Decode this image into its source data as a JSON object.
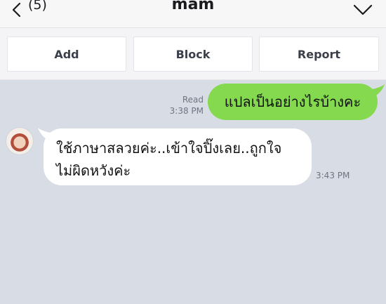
{
  "header": {
    "back_icon": "chevron-left-icon",
    "unread_count": "(5)",
    "title": "mam",
    "menu_icon": "chevron-down-icon"
  },
  "actions": {
    "add_label": "Add",
    "block_label": "Block",
    "report_label": "Report"
  },
  "messages": [
    {
      "direction": "outgoing",
      "status": "Read",
      "time": "3:38 PM",
      "text": "แปลเป็นอย่างไรบ้างคะ",
      "bubble_color": "#84d94f"
    },
    {
      "direction": "incoming",
      "time": "3:43 PM",
      "text_line1": "ใช้ภาษาสลวยค่ะ..เข้าใจปิ๊งเลย..ถูกใจ",
      "text_line2": "ไม่ผิดหวังค่ะ",
      "bubble_color": "#ffffff"
    }
  ],
  "colors": {
    "chat_background": "#d8dce5",
    "header_background": "#f7f7f8",
    "button_text": "#3a3f4a"
  }
}
